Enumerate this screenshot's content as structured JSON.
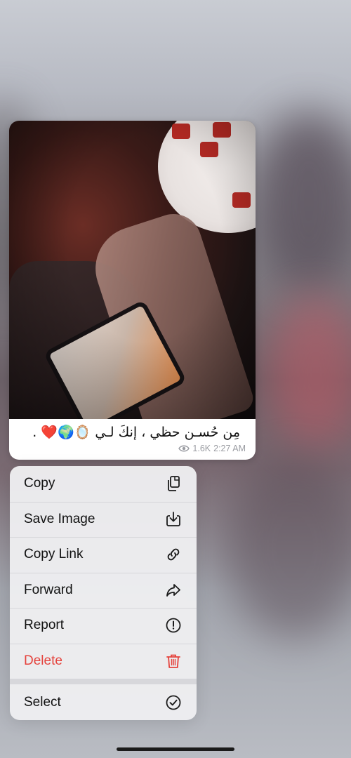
{
  "message": {
    "caption": "مِن حُسـن حظي ، إنكَ لـي 🪞🌍❤️ .",
    "views": "1.6K",
    "time": "2:27 AM"
  },
  "context_menu": {
    "items": [
      {
        "label": "Copy",
        "icon": "copy-icon"
      },
      {
        "label": "Save Image",
        "icon": "save-image-icon"
      },
      {
        "label": "Copy Link",
        "icon": "link-icon"
      },
      {
        "label": "Forward",
        "icon": "forward-icon"
      },
      {
        "label": "Report",
        "icon": "report-icon"
      },
      {
        "label": "Delete",
        "icon": "trash-icon",
        "color": "#e5433d"
      }
    ],
    "secondary": {
      "label": "Select",
      "icon": "select-check-icon"
    }
  },
  "colors": {
    "danger": "#e5433d",
    "bubble": "#ffffff",
    "meta": "#9a9ca2"
  }
}
